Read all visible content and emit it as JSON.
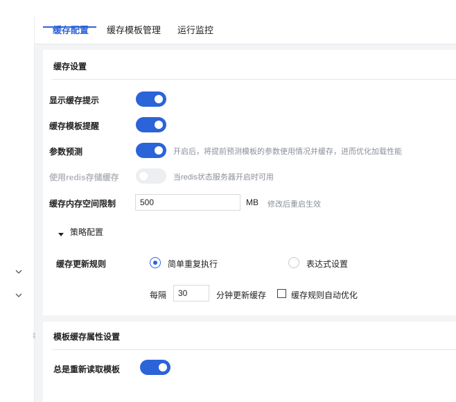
{
  "tabs": [
    {
      "label": "缓存配置",
      "active": true
    },
    {
      "label": "缓存模板管理",
      "active": false
    },
    {
      "label": "运行监控",
      "active": false
    }
  ],
  "section1": {
    "title": "缓存设置",
    "show_cache_tip": {
      "label": "显示缓存提示",
      "on": true
    },
    "template_reminder": {
      "label": "缓存模板提醒",
      "on": true
    },
    "param_prediction": {
      "label": "参数预测",
      "on": true,
      "hint": "开启后，将提前预测模板的参数使用情况并缓存，进而优化加载性能"
    },
    "use_redis": {
      "label": "使用redis存储缓存",
      "on": false,
      "disabled": true,
      "hint": "当redis状态服务器开启时可用"
    },
    "memory_limit": {
      "label": "缓存内存空间限制",
      "value": "500",
      "unit": "MB",
      "hint": "修改后重启生效"
    },
    "strategy": {
      "title": "策略配置",
      "update_rule_label": "缓存更新规则",
      "options": [
        {
          "label": "简单重复执行",
          "checked": true
        },
        {
          "label": "表达式设置",
          "checked": false
        }
      ],
      "interval_prefix": "每隔",
      "interval_value": "30",
      "interval_suffix": "分钟更新缓存",
      "auto_optimize_label": "缓存规则自动优化",
      "auto_optimize_checked": false
    }
  },
  "section2": {
    "title": "模板缓存属性设置",
    "always_reload": {
      "label": "总是重新读取模板",
      "on": true
    }
  },
  "icons": {
    "left_rail": [
      "chevron-down-icon",
      "chevron-down-icon"
    ],
    "drag_handle": "drag-handle-icon"
  },
  "colors": {
    "accent": "#2b63d9",
    "background": "#f3f4f6",
    "hint_text": "#8a8f98",
    "disabled_text": "#b5b8bd"
  }
}
